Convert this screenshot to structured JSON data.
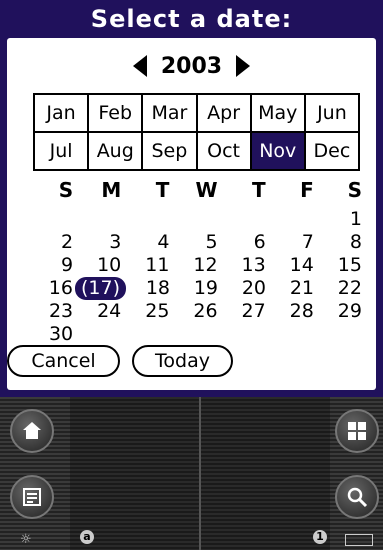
{
  "title": "Select a date:",
  "year": "2003",
  "months": [
    "Jan",
    "Feb",
    "Mar",
    "Apr",
    "May",
    "Jun",
    "Jul",
    "Aug",
    "Sep",
    "Oct",
    "Nov",
    "Dec"
  ],
  "selected_month": "Nov",
  "weekdays": [
    "S",
    "M",
    "T",
    "W",
    "T",
    "F",
    "S"
  ],
  "weeks": [
    [
      "",
      "",
      "",
      "",
      "",
      "",
      "1"
    ],
    [
      "2",
      "3",
      "4",
      "5",
      "6",
      "7",
      "8"
    ],
    [
      "9",
      "10",
      "11",
      "12",
      "13",
      "14",
      "15"
    ],
    [
      "16",
      "(17)",
      "18",
      "19",
      "20",
      "21",
      "22"
    ],
    [
      "23",
      "24",
      "25",
      "26",
      "27",
      "28",
      "29"
    ],
    [
      "30",
      "",
      "",
      "",
      "",
      "",
      ""
    ]
  ],
  "selected_day": "(17)",
  "buttons": {
    "cancel": "Cancel",
    "today": "Today"
  },
  "graffiti": {
    "abc_label": "a",
    "num_label": "1"
  },
  "icons": {
    "prev_year": "left-arrow-icon",
    "next_year": "right-arrow-icon",
    "home": "home-icon",
    "menu": "menu-icon",
    "calculator": "calculator-icon",
    "find": "find-icon",
    "brightness": "brightness-icon",
    "keyboard": "keyboard-icon"
  },
  "colors": {
    "accent": "#20115c",
    "background": "#ffffff"
  }
}
